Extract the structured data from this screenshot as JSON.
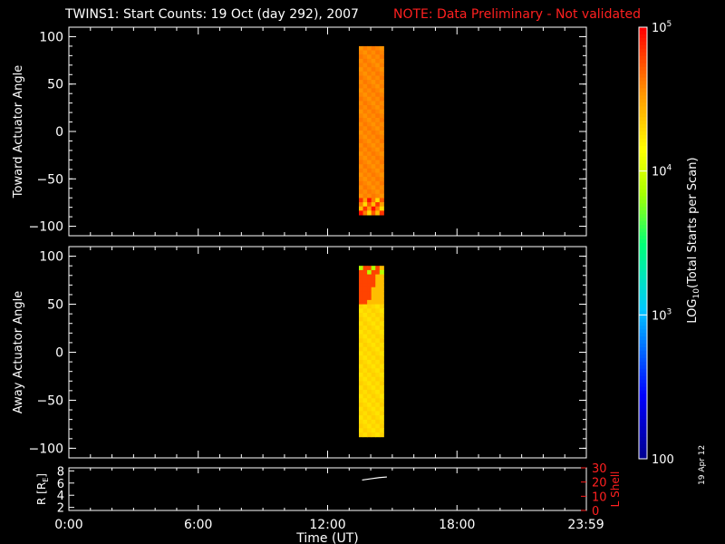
{
  "title": "TWINS1: Start Counts: 19 Oct (day 292), 2007",
  "note": "NOTE: Data Preliminary - Not validated",
  "date_stamp": "19 Apr 12",
  "colors": {
    "background": "#000000",
    "foreground": "#ffffff",
    "note": "#ff2020",
    "lshell": "#ff2020"
  },
  "chart_data": [
    {
      "type": "heatmap",
      "panel": "top",
      "ylabel": "Toward Actuator Angle",
      "ylim": [
        -110,
        110
      ],
      "yticks": [
        -100,
        -50,
        0,
        50,
        100
      ],
      "x_start_hours": 13.45,
      "x_end_hours": 14.6,
      "y_start": -88,
      "y_end": 90,
      "level_log10": 4.6,
      "bottom_band": {
        "y_from": -88,
        "y_to": -70,
        "level_log10": "mixed 4.3-5.0"
      }
    },
    {
      "type": "heatmap",
      "panel": "middle",
      "ylabel": "Away Actuator Angle",
      "ylim": [
        -110,
        110
      ],
      "yticks": [
        -100,
        -50,
        0,
        50,
        100
      ],
      "x_start_hours": 13.45,
      "x_end_hours": 14.6,
      "y_start": -88,
      "y_end": 90,
      "level_log10": 4.3,
      "top_band": {
        "y_from": 50,
        "y_to": 90,
        "level_log10": 4.8
      }
    },
    {
      "type": "line",
      "panel": "bottom",
      "ylabel": "R [R",
      "ylabel_sub": "E",
      "ylabel_end": "]",
      "ylim": [
        1.5,
        8.5
      ],
      "yticks": [
        2,
        4,
        6,
        8
      ],
      "y2label": "L Shell",
      "y2lim": [
        0,
        30
      ],
      "y2ticks": [
        0,
        10,
        20,
        30
      ],
      "series": [
        {
          "x": [
            13.6,
            14.0,
            14.4,
            14.75
          ],
          "y": [
            6.5,
            6.7,
            6.9,
            7.0
          ]
        }
      ]
    }
  ],
  "xaxis": {
    "label": "Time (UT)",
    "tick_labels": [
      "0:00",
      "6:00",
      "12:00",
      "18:00",
      "23:59"
    ],
    "tick_values_hours": [
      0,
      6,
      12,
      18,
      23.98
    ],
    "xlim_hours": [
      0,
      24
    ]
  },
  "colorbar": {
    "label": "(Total Starts per Scan)",
    "label_prefix": "LOG",
    "label_sub": "10",
    "log_min": 2,
    "log_max": 5,
    "tick_labels": [
      {
        "value_log10": 2,
        "base": "100",
        "exp": ""
      },
      {
        "value_log10": 3,
        "base": "10",
        "exp": "3"
      },
      {
        "value_log10": 4,
        "base": "10",
        "exp": "4"
      },
      {
        "value_log10": 5,
        "base": "10",
        "exp": "5"
      }
    ]
  }
}
